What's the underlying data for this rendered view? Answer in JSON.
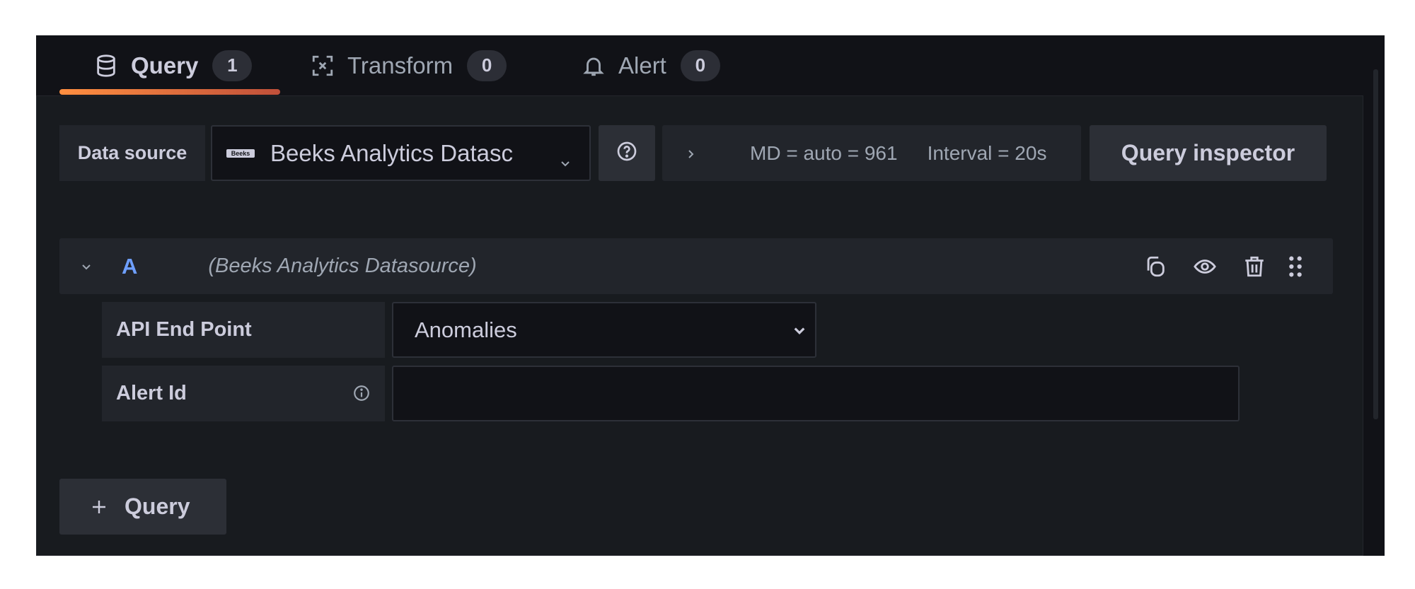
{
  "tabs": [
    {
      "label": "Query",
      "count": "1",
      "icon": "database-icon",
      "active": true
    },
    {
      "label": "Transform",
      "count": "0",
      "icon": "transform-icon",
      "active": false
    },
    {
      "label": "Alert",
      "count": "0",
      "icon": "bell-icon",
      "active": false
    }
  ],
  "toolbar": {
    "datasource_label": "Data source",
    "datasource_value": "Beeks Analytics Datasc",
    "datasource_logo_text": "Beeks",
    "options_summary_md": "MD = auto = 961",
    "options_summary_interval": "Interval = 20s",
    "query_inspector_label": "Query inspector"
  },
  "query": {
    "ref_id": "A",
    "datasource_name": "(Beeks Analytics Datasource)",
    "fields": {
      "api_endpoint_label": "API End Point",
      "api_endpoint_value": "Anomalies",
      "alert_id_label": "Alert Id",
      "alert_id_value": ""
    }
  },
  "add_query_label": "Query",
  "colors": {
    "accent": "#ff8f40",
    "ref_id": "#6e9fff",
    "panel_bg": "#111217",
    "content_bg": "#181b1f"
  }
}
